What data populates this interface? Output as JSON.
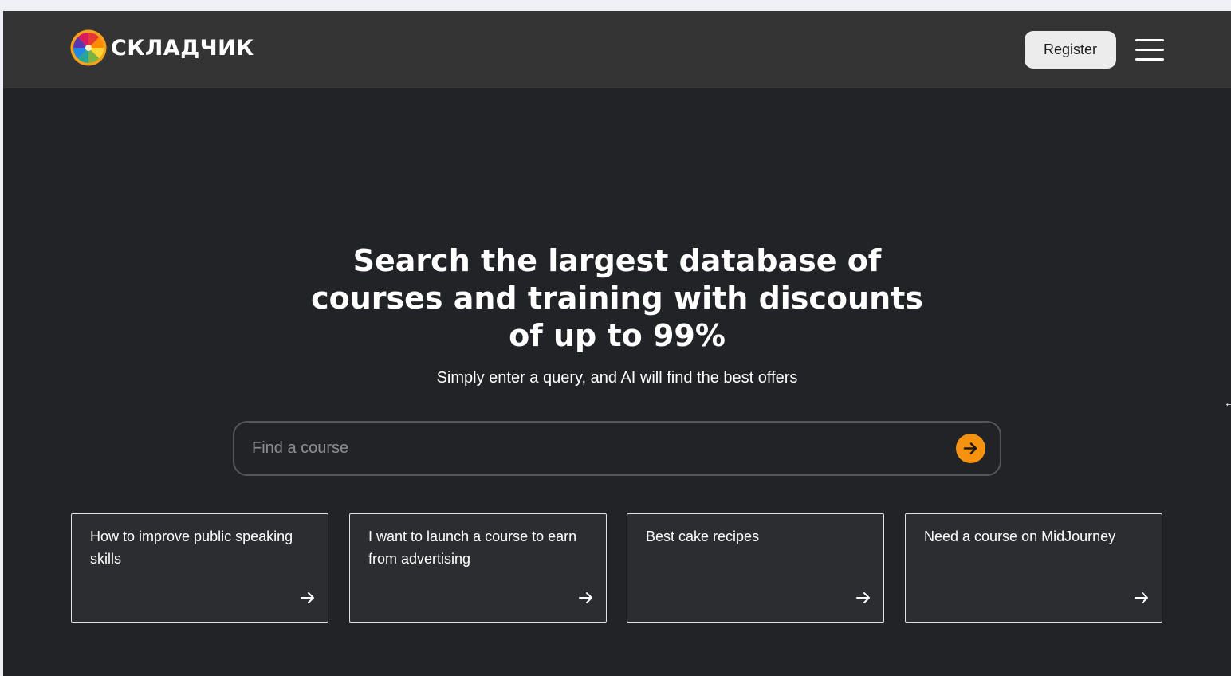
{
  "header": {
    "logo_text": "СКЛАДЧИК",
    "logo_icon": "color-wheel-icon",
    "register_label": "Register",
    "menu_icon": "hamburger-menu-icon"
  },
  "hero": {
    "title": "Search the largest database of courses and training with discounts of up to 99%",
    "subtitle": "Simply enter a query, and AI will find the best offers"
  },
  "search": {
    "placeholder": "Find a course",
    "value": "",
    "submit_icon": "arrow-right-icon",
    "accent_color": "#f5920f"
  },
  "suggestions": [
    {
      "text": "How to improve public speaking skills",
      "icon": "arrow-right-icon"
    },
    {
      "text": "I want to launch a course to earn from advertising",
      "icon": "arrow-right-icon"
    },
    {
      "text": "Best cake recipes",
      "icon": "arrow-right-icon"
    },
    {
      "text": "Need a course on MidJourney",
      "icon": "arrow-right-icon"
    }
  ],
  "colors": {
    "background": "#222327",
    "header_background": "#343434",
    "card_background": "#2c2d31",
    "card_border": "#e0e0e0",
    "accent": "#f5920f"
  },
  "edge_glyph": "←"
}
